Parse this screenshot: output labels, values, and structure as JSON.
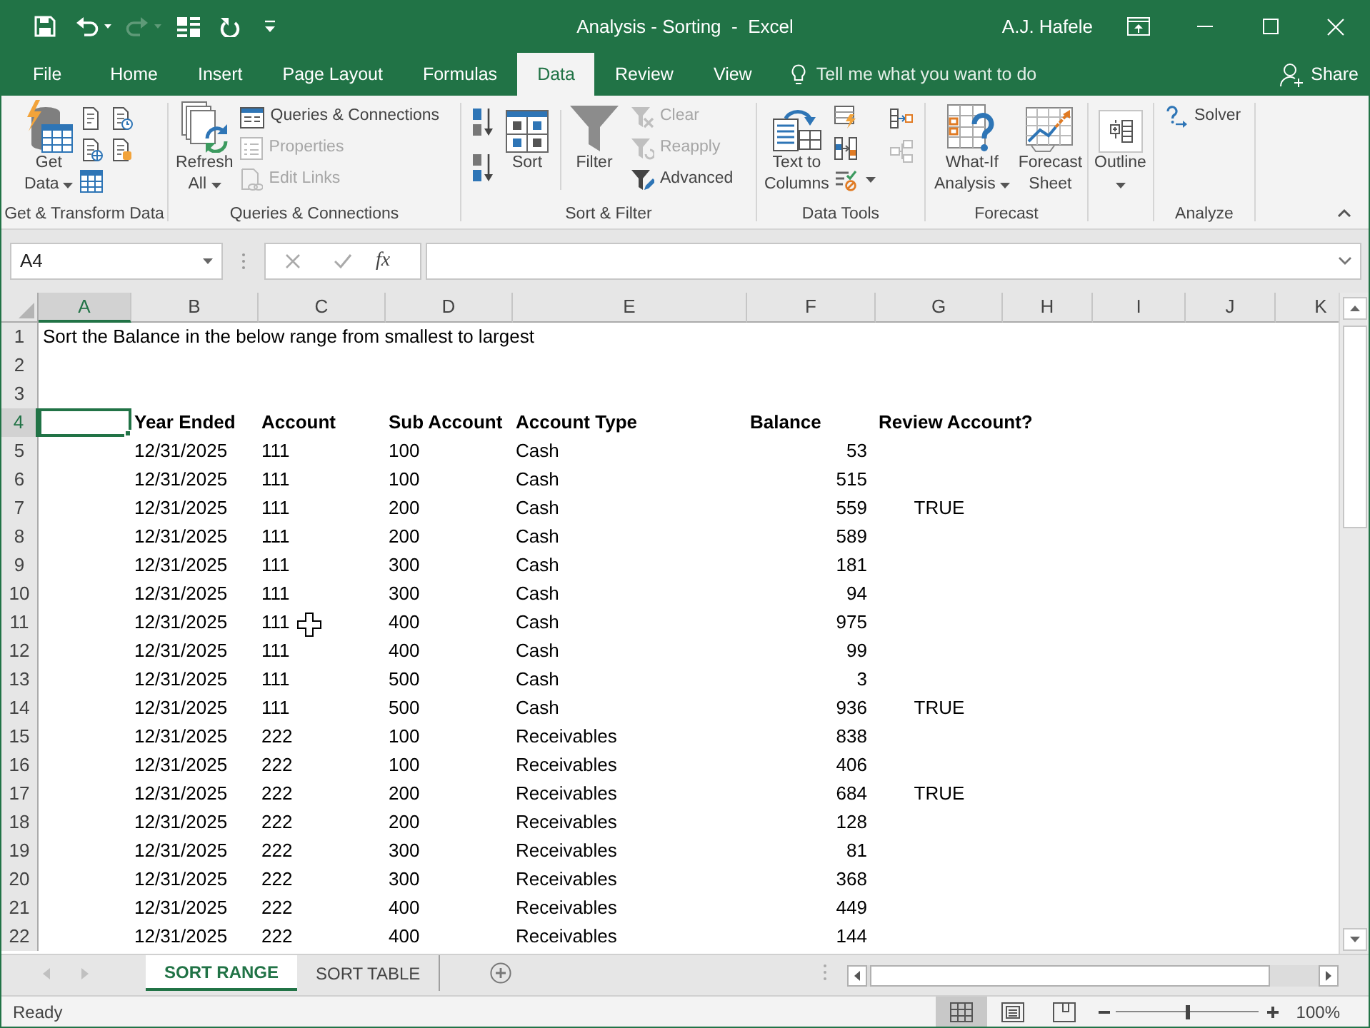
{
  "window": {
    "title": "Analysis - Sorting  -  Excel",
    "user": "A.J. Hafele"
  },
  "ribbon_tabs": [
    {
      "label": "File",
      "selected": false
    },
    {
      "label": "Home",
      "selected": false
    },
    {
      "label": "Insert",
      "selected": false
    },
    {
      "label": "Page Layout",
      "selected": false
    },
    {
      "label": "Formulas",
      "selected": false
    },
    {
      "label": "Data",
      "selected": true
    },
    {
      "label": "Review",
      "selected": false
    },
    {
      "label": "View",
      "selected": false
    }
  ],
  "tell_me": {
    "placeholder": "Tell me what you want to do"
  },
  "share": "Share",
  "ribbon_groups": [
    {
      "kind": "get_transform",
      "label": "Get & Transform Data",
      "buttons": [
        {
          "kind": "get_data",
          "lines": [
            "Get",
            "Data"
          ],
          "dropdown": true
        }
      ]
    },
    {
      "kind": "queries",
      "label": "Queries & Connections",
      "buttons": [
        {
          "kind": "refresh_all",
          "lines": [
            "Refresh",
            "All"
          ],
          "dropdown": true
        }
      ],
      "commands": [
        {
          "kind": "queries_connections",
          "label": "Queries & Connections",
          "disabled": false
        },
        {
          "kind": "properties",
          "label": "Properties",
          "disabled": true
        },
        {
          "kind": "edit_links",
          "label": "Edit Links",
          "disabled": true
        }
      ]
    },
    {
      "kind": "sort_filter",
      "label": "Sort & Filter",
      "buttons": [
        {
          "kind": "sort",
          "lines": [
            "Sort"
          ],
          "dropdown": false
        },
        {
          "kind": "filter",
          "lines": [
            "Filter"
          ],
          "dropdown": false
        }
      ],
      "commands": [
        {
          "kind": "clear",
          "label": "Clear",
          "disabled": true
        },
        {
          "kind": "reapply",
          "label": "Reapply",
          "disabled": true
        },
        {
          "kind": "advanced",
          "label": "Advanced",
          "disabled": false
        }
      ]
    },
    {
      "kind": "data_tools",
      "label": "Data Tools",
      "buttons": [
        {
          "kind": "text_to_columns",
          "lines": [
            "Text to",
            "Columns"
          ],
          "dropdown": false
        }
      ]
    },
    {
      "kind": "forecast",
      "label": "Forecast",
      "buttons": [
        {
          "kind": "what_if",
          "lines": [
            "What-If",
            "Analysis"
          ],
          "dropdown": true
        },
        {
          "kind": "forecast_sheet",
          "lines": [
            "Forecast",
            "Sheet"
          ],
          "dropdown": false
        }
      ]
    },
    {
      "kind": "outline",
      "buttons": [
        {
          "kind": "outline",
          "lines": [
            "Outline"
          ],
          "dropdown": true
        }
      ]
    },
    {
      "kind": "analyze",
      "label": "Analyze",
      "commands": [
        {
          "kind": "solver",
          "label": "Solver",
          "disabled": false
        }
      ]
    }
  ],
  "formula_bar": {
    "name_box": "A4",
    "function_label": "fx"
  },
  "sheet": {
    "columns": [
      {
        "label": "A",
        "selected": true
      },
      {
        "label": "B",
        "selected": false
      },
      {
        "label": "C",
        "selected": false
      },
      {
        "label": "D",
        "selected": false
      },
      {
        "label": "E",
        "selected": false
      },
      {
        "label": "F",
        "selected": false
      },
      {
        "label": "G",
        "selected": false
      },
      {
        "label": "H",
        "selected": false
      },
      {
        "label": "I",
        "selected": false
      },
      {
        "label": "J",
        "selected": false
      },
      {
        "label": "K",
        "selected": false
      }
    ],
    "row_headers": [
      {
        "label": "1",
        "selected": false
      },
      {
        "label": "2",
        "selected": false
      },
      {
        "label": "3",
        "selected": false
      },
      {
        "label": "4",
        "selected": true
      },
      {
        "label": "5",
        "selected": false
      },
      {
        "label": "6",
        "selected": false
      },
      {
        "label": "7",
        "selected": false
      },
      {
        "label": "8",
        "selected": false
      },
      {
        "label": "9",
        "selected": false
      },
      {
        "label": "10",
        "selected": false
      },
      {
        "label": "11",
        "selected": false
      },
      {
        "label": "12",
        "selected": false
      },
      {
        "label": "13",
        "selected": false
      },
      {
        "label": "14",
        "selected": false
      },
      {
        "label": "15",
        "selected": false
      },
      {
        "label": "16",
        "selected": false
      },
      {
        "label": "17",
        "selected": false
      },
      {
        "label": "18",
        "selected": false
      },
      {
        "label": "19",
        "selected": false
      },
      {
        "label": "20",
        "selected": false
      },
      {
        "label": "21",
        "selected": false
      },
      {
        "label": "22",
        "selected": false
      }
    ],
    "note": "Sort the Balance in the below range from smallest to largest",
    "table": {
      "columns": [
        "Year Ended",
        "Account",
        "Sub Account",
        "Account Type",
        "Balance",
        "Review Account?"
      ],
      "rows": [
        [
          "12/31/2025",
          "111",
          "100",
          "Cash",
          "53"
        ],
        [
          "12/31/2025",
          "111",
          "100",
          "Cash",
          "515"
        ],
        [
          "12/31/2025",
          "111",
          "200",
          "Cash",
          "559",
          "TRUE"
        ],
        [
          "12/31/2025",
          "111",
          "200",
          "Cash",
          "589"
        ],
        [
          "12/31/2025",
          "111",
          "300",
          "Cash",
          "181"
        ],
        [
          "12/31/2025",
          "111",
          "300",
          "Cash",
          "94"
        ],
        [
          "12/31/2025",
          "111",
          "400",
          "Cash",
          "975"
        ],
        [
          "12/31/2025",
          "111",
          "400",
          "Cash",
          "99"
        ],
        [
          "12/31/2025",
          "111",
          "500",
          "Cash",
          "3"
        ],
        [
          "12/31/2025",
          "111",
          "500",
          "Cash",
          "936",
          "TRUE"
        ],
        [
          "12/31/2025",
          "222",
          "100",
          "Receivables",
          "838"
        ],
        [
          "12/31/2025",
          "222",
          "100",
          "Receivables",
          "406"
        ],
        [
          "12/31/2025",
          "222",
          "200",
          "Receivables",
          "684",
          "TRUE"
        ],
        [
          "12/31/2025",
          "222",
          "200",
          "Receivables",
          "128"
        ],
        [
          "12/31/2025",
          "222",
          "300",
          "Receivables",
          "81"
        ],
        [
          "12/31/2025",
          "222",
          "300",
          "Receivables",
          "368"
        ],
        [
          "12/31/2025",
          "222",
          "400",
          "Receivables",
          "449"
        ],
        [
          "12/31/2025",
          "222",
          "400",
          "Receivables",
          "144"
        ]
      ]
    }
  },
  "sheet_tabs": [
    {
      "label": "SORT RANGE",
      "selected": true
    },
    {
      "label": "SORT TABLE",
      "selected": false
    }
  ],
  "status_bar": {
    "status": "Ready",
    "views": [
      {
        "kind": "normal",
        "selected": true
      },
      {
        "kind": "page_layout",
        "selected": false
      },
      {
        "kind": "page_break_preview",
        "selected": false
      }
    ],
    "zoom": {
      "level": 0.5,
      "reading": "100%"
    }
  }
}
